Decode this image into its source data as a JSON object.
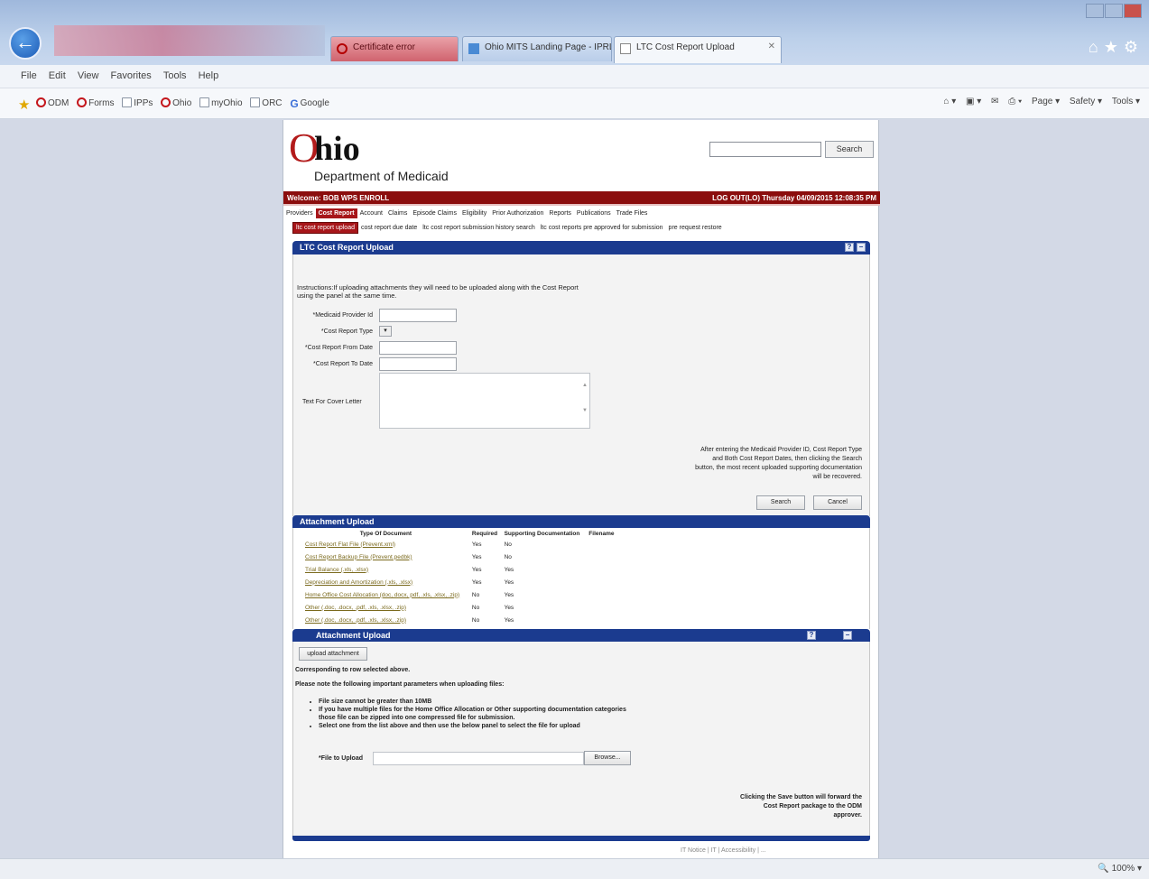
{
  "browser": {
    "tabs": [
      {
        "label": "Certificate error"
      },
      {
        "label": "Ohio MITS Landing Page - IPRL..."
      },
      {
        "label": "LTC Cost Report Upload"
      }
    ],
    "menu": [
      "File",
      "Edit",
      "View",
      "Favorites",
      "Tools",
      "Help"
    ],
    "favorites": [
      "ODM",
      "Forms",
      "IPPs",
      "Ohio",
      "myOhio",
      "ORC",
      "Google"
    ],
    "commands": [
      "Page ▾",
      "Safety ▾",
      "Tools ▾"
    ],
    "zoom": "100%"
  },
  "site": {
    "logo_o": "O",
    "logo_rest": "hio",
    "department": "Department of Medicaid",
    "search_button": "Search",
    "welcome": "Welcome: BOB WPS ENROLL",
    "welcome_right": "LOG OUT(LO)     Thursday 04/09/2015 12:08:35 PM",
    "main_nav": [
      "Providers",
      "Cost Report",
      "Account",
      "Claims",
      "Episode Claims",
      "Eligibility",
      "Prior Authorization",
      "Reports",
      "Publications",
      "Trade Files"
    ],
    "main_nav_active": 1,
    "sub_nav": [
      "ltc cost report upload",
      "cost report due date",
      "ltc cost report submission history search",
      "ltc cost reports pre approved for submission",
      "pre request restore"
    ],
    "sub_nav_active": 0
  },
  "cost_report_panel": {
    "title": "LTC Cost Report Upload",
    "instructions": "Instructions:If uploading attachments they will need to be uploaded along with the Cost Report using the panel at the same time.",
    "fields": [
      {
        "label": "*Medicaid Provider Id"
      },
      {
        "label": "*Cost Report Type",
        "type": "select"
      },
      {
        "label": "*Cost Report From Date"
      },
      {
        "label": "*Cost Report To Date"
      }
    ],
    "cover_letter_label": "Text For Cover Letter",
    "search_hint": "After entering the Medicaid Provider ID, Cost Report Type and Both Cost Report Dates, then clicking the Search button, the most recent uploaded supporting documentation will be recovered.",
    "search_button": "Search",
    "cancel_button": "Cancel"
  },
  "attachment_table": {
    "title": "Attachment Upload",
    "columns": [
      "Type Of Document",
      "Required",
      "Supporting Documentation",
      "Filename"
    ],
    "rows": [
      [
        "Cost Report Flat File (Prevent.xml)",
        "Yes",
        "No",
        ""
      ],
      [
        "Cost Report Backup File (Prevent.pedbk)",
        "Yes",
        "No",
        ""
      ],
      [
        "Trial Balance (.xls, .xlsx)",
        "Yes",
        "Yes",
        ""
      ],
      [
        "Depreciation and Amortization (.xls, .xlsx)",
        "Yes",
        "Yes",
        ""
      ],
      [
        "Home Office Cost Allocation (doc, docx, pdf, .xls, .xlsx, .zip)",
        "No",
        "Yes",
        ""
      ],
      [
        "Other (.doc, .docx, .pdf, .xls, .xlsx, .zip)",
        "No",
        "Yes",
        ""
      ],
      [
        "Other (.doc, .docx, .pdf, .xls, .xlsx, .zip)",
        "No",
        "Yes",
        ""
      ]
    ]
  },
  "upload_panel": {
    "title": "Attachment Upload",
    "upload_button": "upload attachment",
    "corresponding": "Corresponding to row selected above.",
    "note": "Please note the following important parameters when uploading files:",
    "bullets": [
      "File size cannot be greater than 10MB",
      "If you have multiple files for the Home Office Allocation or Other supporting documentation categories those file can be zipped into one compressed file for submission.",
      "Select one from the list above and then use the below panel to select the file for upload"
    ],
    "file_label": "*File to Upload",
    "browse_button": "Browse...",
    "save_hint": "Clicking the Save button will forward the Cost Report package to the ODM approver."
  },
  "footer": "IT Notice | IT | Accessibility | ..."
}
